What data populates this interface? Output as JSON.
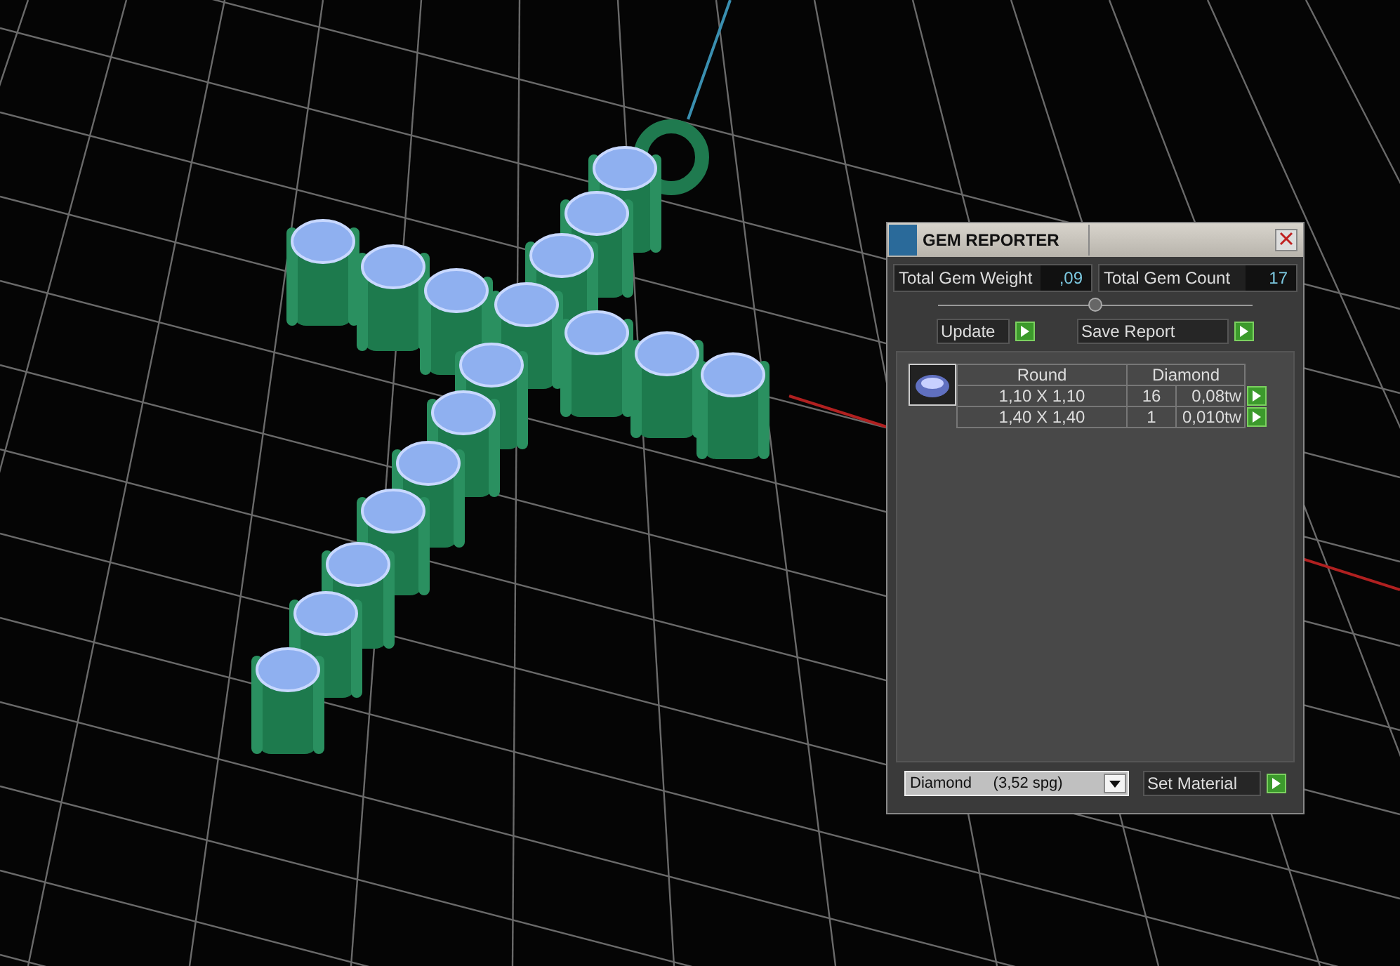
{
  "panel": {
    "title": "GEM REPORTER",
    "totals": [
      {
        "label": "Total Gem Weight",
        "value": ",09"
      },
      {
        "label": "Total Gem Count",
        "value": "17"
      }
    ],
    "buttons": [
      "Update",
      "Save Report"
    ],
    "gem_table": {
      "shape": "Round",
      "material": "Diamond",
      "rows": [
        {
          "size": "1,10 X 1,10",
          "count": "16",
          "weight": "0,08tw"
        },
        {
          "size": "1,40 X 1,40",
          "count": "1",
          "weight": "0,010tw"
        }
      ]
    },
    "material_select": {
      "value": "Diamond     (3,52 spg)"
    },
    "set_button": "Set Material"
  }
}
